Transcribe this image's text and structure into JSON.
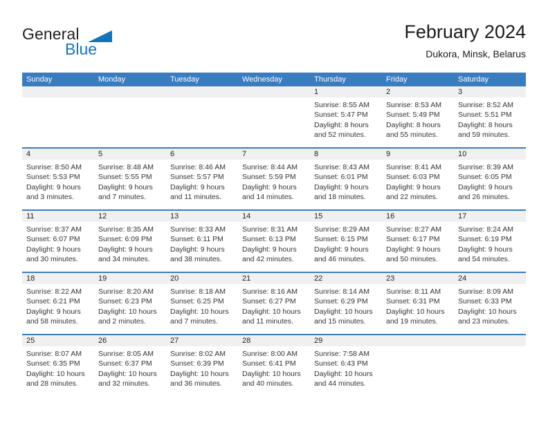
{
  "brand": {
    "name_part1": "General",
    "name_part2": "Blue",
    "accent_color": "#1274bd"
  },
  "header": {
    "title": "February 2024",
    "subtitle": "Dukora, Minsk, Belarus"
  },
  "theme": {
    "header_blue": "#3a7cc0",
    "band_gray": "#f0f0f0"
  },
  "weekdays": [
    "Sunday",
    "Monday",
    "Tuesday",
    "Wednesday",
    "Thursday",
    "Friday",
    "Saturday"
  ],
  "weeks": [
    [
      {
        "day": "",
        "sunrise": "",
        "sunset": "",
        "daylight_line1": "",
        "daylight_line2": ""
      },
      {
        "day": "",
        "sunrise": "",
        "sunset": "",
        "daylight_line1": "",
        "daylight_line2": ""
      },
      {
        "day": "",
        "sunrise": "",
        "sunset": "",
        "daylight_line1": "",
        "daylight_line2": ""
      },
      {
        "day": "",
        "sunrise": "",
        "sunset": "",
        "daylight_line1": "",
        "daylight_line2": ""
      },
      {
        "day": "1",
        "sunrise": "Sunrise: 8:55 AM",
        "sunset": "Sunset: 5:47 PM",
        "daylight_line1": "Daylight: 8 hours",
        "daylight_line2": "and 52 minutes."
      },
      {
        "day": "2",
        "sunrise": "Sunrise: 8:53 AM",
        "sunset": "Sunset: 5:49 PM",
        "daylight_line1": "Daylight: 8 hours",
        "daylight_line2": "and 55 minutes."
      },
      {
        "day": "3",
        "sunrise": "Sunrise: 8:52 AM",
        "sunset": "Sunset: 5:51 PM",
        "daylight_line1": "Daylight: 8 hours",
        "daylight_line2": "and 59 minutes."
      }
    ],
    [
      {
        "day": "4",
        "sunrise": "Sunrise: 8:50 AM",
        "sunset": "Sunset: 5:53 PM",
        "daylight_line1": "Daylight: 9 hours",
        "daylight_line2": "and 3 minutes."
      },
      {
        "day": "5",
        "sunrise": "Sunrise: 8:48 AM",
        "sunset": "Sunset: 5:55 PM",
        "daylight_line1": "Daylight: 9 hours",
        "daylight_line2": "and 7 minutes."
      },
      {
        "day": "6",
        "sunrise": "Sunrise: 8:46 AM",
        "sunset": "Sunset: 5:57 PM",
        "daylight_line1": "Daylight: 9 hours",
        "daylight_line2": "and 11 minutes."
      },
      {
        "day": "7",
        "sunrise": "Sunrise: 8:44 AM",
        "sunset": "Sunset: 5:59 PM",
        "daylight_line1": "Daylight: 9 hours",
        "daylight_line2": "and 14 minutes."
      },
      {
        "day": "8",
        "sunrise": "Sunrise: 8:43 AM",
        "sunset": "Sunset: 6:01 PM",
        "daylight_line1": "Daylight: 9 hours",
        "daylight_line2": "and 18 minutes."
      },
      {
        "day": "9",
        "sunrise": "Sunrise: 8:41 AM",
        "sunset": "Sunset: 6:03 PM",
        "daylight_line1": "Daylight: 9 hours",
        "daylight_line2": "and 22 minutes."
      },
      {
        "day": "10",
        "sunrise": "Sunrise: 8:39 AM",
        "sunset": "Sunset: 6:05 PM",
        "daylight_line1": "Daylight: 9 hours",
        "daylight_line2": "and 26 minutes."
      }
    ],
    [
      {
        "day": "11",
        "sunrise": "Sunrise: 8:37 AM",
        "sunset": "Sunset: 6:07 PM",
        "daylight_line1": "Daylight: 9 hours",
        "daylight_line2": "and 30 minutes."
      },
      {
        "day": "12",
        "sunrise": "Sunrise: 8:35 AM",
        "sunset": "Sunset: 6:09 PM",
        "daylight_line1": "Daylight: 9 hours",
        "daylight_line2": "and 34 minutes."
      },
      {
        "day": "13",
        "sunrise": "Sunrise: 8:33 AM",
        "sunset": "Sunset: 6:11 PM",
        "daylight_line1": "Daylight: 9 hours",
        "daylight_line2": "and 38 minutes."
      },
      {
        "day": "14",
        "sunrise": "Sunrise: 8:31 AM",
        "sunset": "Sunset: 6:13 PM",
        "daylight_line1": "Daylight: 9 hours",
        "daylight_line2": "and 42 minutes."
      },
      {
        "day": "15",
        "sunrise": "Sunrise: 8:29 AM",
        "sunset": "Sunset: 6:15 PM",
        "daylight_line1": "Daylight: 9 hours",
        "daylight_line2": "and 46 minutes."
      },
      {
        "day": "16",
        "sunrise": "Sunrise: 8:27 AM",
        "sunset": "Sunset: 6:17 PM",
        "daylight_line1": "Daylight: 9 hours",
        "daylight_line2": "and 50 minutes."
      },
      {
        "day": "17",
        "sunrise": "Sunrise: 8:24 AM",
        "sunset": "Sunset: 6:19 PM",
        "daylight_line1": "Daylight: 9 hours",
        "daylight_line2": "and 54 minutes."
      }
    ],
    [
      {
        "day": "18",
        "sunrise": "Sunrise: 8:22 AM",
        "sunset": "Sunset: 6:21 PM",
        "daylight_line1": "Daylight: 9 hours",
        "daylight_line2": "and 58 minutes."
      },
      {
        "day": "19",
        "sunrise": "Sunrise: 8:20 AM",
        "sunset": "Sunset: 6:23 PM",
        "daylight_line1": "Daylight: 10 hours",
        "daylight_line2": "and 2 minutes."
      },
      {
        "day": "20",
        "sunrise": "Sunrise: 8:18 AM",
        "sunset": "Sunset: 6:25 PM",
        "daylight_line1": "Daylight: 10 hours",
        "daylight_line2": "and 7 minutes."
      },
      {
        "day": "21",
        "sunrise": "Sunrise: 8:16 AM",
        "sunset": "Sunset: 6:27 PM",
        "daylight_line1": "Daylight: 10 hours",
        "daylight_line2": "and 11 minutes."
      },
      {
        "day": "22",
        "sunrise": "Sunrise: 8:14 AM",
        "sunset": "Sunset: 6:29 PM",
        "daylight_line1": "Daylight: 10 hours",
        "daylight_line2": "and 15 minutes."
      },
      {
        "day": "23",
        "sunrise": "Sunrise: 8:11 AM",
        "sunset": "Sunset: 6:31 PM",
        "daylight_line1": "Daylight: 10 hours",
        "daylight_line2": "and 19 minutes."
      },
      {
        "day": "24",
        "sunrise": "Sunrise: 8:09 AM",
        "sunset": "Sunset: 6:33 PM",
        "daylight_line1": "Daylight: 10 hours",
        "daylight_line2": "and 23 minutes."
      }
    ],
    [
      {
        "day": "25",
        "sunrise": "Sunrise: 8:07 AM",
        "sunset": "Sunset: 6:35 PM",
        "daylight_line1": "Daylight: 10 hours",
        "daylight_line2": "and 28 minutes."
      },
      {
        "day": "26",
        "sunrise": "Sunrise: 8:05 AM",
        "sunset": "Sunset: 6:37 PM",
        "daylight_line1": "Daylight: 10 hours",
        "daylight_line2": "and 32 minutes."
      },
      {
        "day": "27",
        "sunrise": "Sunrise: 8:02 AM",
        "sunset": "Sunset: 6:39 PM",
        "daylight_line1": "Daylight: 10 hours",
        "daylight_line2": "and 36 minutes."
      },
      {
        "day": "28",
        "sunrise": "Sunrise: 8:00 AM",
        "sunset": "Sunset: 6:41 PM",
        "daylight_line1": "Daylight: 10 hours",
        "daylight_line2": "and 40 minutes."
      },
      {
        "day": "29",
        "sunrise": "Sunrise: 7:58 AM",
        "sunset": "Sunset: 6:43 PM",
        "daylight_line1": "Daylight: 10 hours",
        "daylight_line2": "and 44 minutes."
      },
      {
        "day": "",
        "sunrise": "",
        "sunset": "",
        "daylight_line1": "",
        "daylight_line2": ""
      },
      {
        "day": "",
        "sunrise": "",
        "sunset": "",
        "daylight_line1": "",
        "daylight_line2": ""
      }
    ]
  ]
}
